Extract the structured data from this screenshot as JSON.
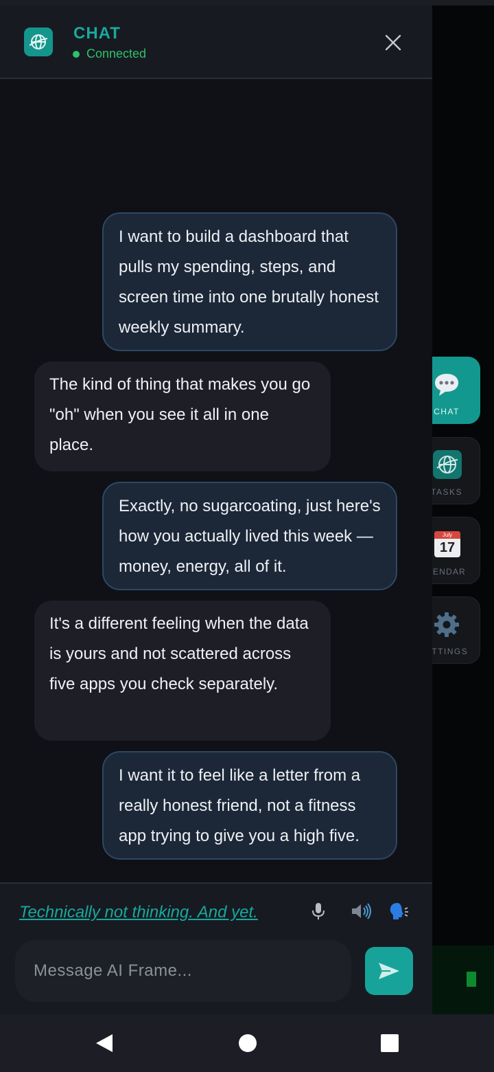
{
  "header": {
    "title": "CHAT",
    "status": "Connected"
  },
  "messages": [
    {
      "role": "user",
      "text": "I want to build a dashboard that pulls my spending, steps, and screen time into one brutally honest weekly summary."
    },
    {
      "role": "ai",
      "text": "The kind of thing that makes you go \"oh\" when you see it all in one place."
    },
    {
      "role": "user",
      "text": "Exactly, no sugarcoating, just here's how you actually lived this week — money, energy, all of it."
    },
    {
      "role": "ai",
      "text": "It's a different feeling when the data is yours and not scattered across five apps you check separately."
    },
    {
      "role": "user",
      "text": "I want it to feel like a letter from a really honest friend, not a fitness app trying to give you a high five."
    }
  ],
  "footer": {
    "tagline": "Technically not thinking. And yet.",
    "input_placeholder": "Message AI Frame..."
  },
  "rail": {
    "items": [
      {
        "label": "CHAT",
        "icon": "chat-bubble-icon",
        "active": true
      },
      {
        "label": "TASKS",
        "icon": "globe-icon",
        "active": false
      },
      {
        "label": "LENDAR",
        "icon": "calendar-icon",
        "active": false,
        "calendar_month": "July",
        "calendar_day": "17"
      },
      {
        "label": "ETTINGS",
        "icon": "gear-icon",
        "active": false
      }
    ]
  },
  "colors": {
    "accent": "#17a39a",
    "status": "#2fc06b",
    "user_bubble": "#1c2838",
    "ai_bubble": "#1e1f26"
  }
}
